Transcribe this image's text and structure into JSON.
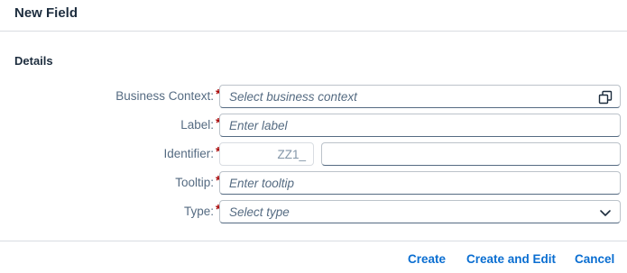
{
  "dialog": {
    "title": "New Field",
    "section_title": "Details"
  },
  "form": {
    "business_context": {
      "label": "Business Context:",
      "required_mark": "*",
      "placeholder": "Select business context",
      "icon": "value-help-icon"
    },
    "label_field": {
      "label": "Label:",
      "required_mark": "*",
      "placeholder": "Enter label"
    },
    "identifier": {
      "label": "Identifier:",
      "required_mark": "*",
      "prefix": "ZZ1_",
      "value": ""
    },
    "tooltip": {
      "label": "Tooltip:",
      "required_mark": "*",
      "placeholder": "Enter tooltip"
    },
    "type": {
      "label": "Type:",
      "required_mark": "*",
      "placeholder": "Select type",
      "icon": "chevron-down-icon"
    }
  },
  "footer": {
    "create_label": "Create",
    "create_and_edit_label": "Create and Edit",
    "cancel_label": "Cancel"
  },
  "colors": {
    "accent": "#0a6ed1",
    "required": "#aa0808",
    "label": "#556b82"
  }
}
